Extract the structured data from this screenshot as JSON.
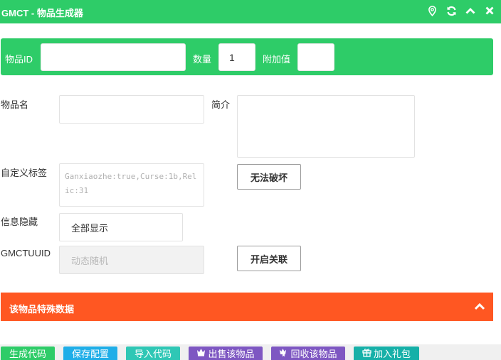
{
  "titlebar": {
    "title": "GMCT - 物品生成器",
    "icons": [
      "location-icon",
      "refresh-icon",
      "chevron-up-icon",
      "close-icon"
    ]
  },
  "idbar": {
    "item_id_label": "物品ID",
    "item_id_value": "",
    "quantity_label": "数量",
    "quantity_value": "1",
    "extra_label": "附加值",
    "extra_value": ""
  },
  "form": {
    "item_name_label": "物品名",
    "item_name_value": "",
    "intro_label": "简介",
    "intro_value": "",
    "custom_tag_label": "自定义标签",
    "custom_tag_placeholder": "Ganxiaozhe:true,Curse:1b,Relic:31",
    "unbreakable_button": "无法破坏",
    "info_hide_label": "信息隐藏",
    "info_hide_selected": "全部显示",
    "uuid_label": "GMCTUUID",
    "uuid_placeholder": "动态随机",
    "link_button": "开启关联"
  },
  "special_section": {
    "title": "该物品特殊数据"
  },
  "footer": {
    "buttons": [
      {
        "label": "生成代码",
        "color": "#2ecc68"
      },
      {
        "label": "保存配置",
        "color": "#1faee8"
      },
      {
        "label": "导入代码",
        "color": "#2fc7b5"
      },
      {
        "label": "出售该物品",
        "color": "#7e57c2",
        "icon": "crown-icon"
      },
      {
        "label": "回收该物品",
        "color": "#7e57c2",
        "icon": "recycle-icon"
      },
      {
        "label": "加入礼包",
        "color": "#16b0a8",
        "icon": "gift-icon"
      }
    ]
  },
  "colors": {
    "primary_green": "#2ecc68",
    "accent_orange": "#ff5722"
  }
}
